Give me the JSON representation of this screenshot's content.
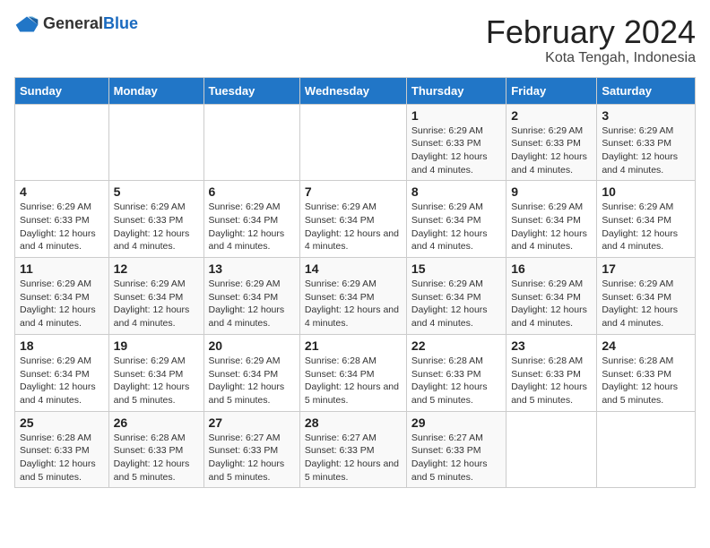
{
  "logo": {
    "text_general": "General",
    "text_blue": "Blue"
  },
  "title": "February 2024",
  "subtitle": "Kota Tengah, Indonesia",
  "days_of_week": [
    "Sunday",
    "Monday",
    "Tuesday",
    "Wednesday",
    "Thursday",
    "Friday",
    "Saturday"
  ],
  "weeks": [
    [
      {
        "day": "",
        "sunrise": "",
        "sunset": "",
        "daylight": ""
      },
      {
        "day": "",
        "sunrise": "",
        "sunset": "",
        "daylight": ""
      },
      {
        "day": "",
        "sunrise": "",
        "sunset": "",
        "daylight": ""
      },
      {
        "day": "",
        "sunrise": "",
        "sunset": "",
        "daylight": ""
      },
      {
        "day": "1",
        "sunrise": "Sunrise: 6:29 AM",
        "sunset": "Sunset: 6:33 PM",
        "daylight": "Daylight: 12 hours and 4 minutes."
      },
      {
        "day": "2",
        "sunrise": "Sunrise: 6:29 AM",
        "sunset": "Sunset: 6:33 PM",
        "daylight": "Daylight: 12 hours and 4 minutes."
      },
      {
        "day": "3",
        "sunrise": "Sunrise: 6:29 AM",
        "sunset": "Sunset: 6:33 PM",
        "daylight": "Daylight: 12 hours and 4 minutes."
      }
    ],
    [
      {
        "day": "4",
        "sunrise": "Sunrise: 6:29 AM",
        "sunset": "Sunset: 6:33 PM",
        "daylight": "Daylight: 12 hours and 4 minutes."
      },
      {
        "day": "5",
        "sunrise": "Sunrise: 6:29 AM",
        "sunset": "Sunset: 6:33 PM",
        "daylight": "Daylight: 12 hours and 4 minutes."
      },
      {
        "day": "6",
        "sunrise": "Sunrise: 6:29 AM",
        "sunset": "Sunset: 6:34 PM",
        "daylight": "Daylight: 12 hours and 4 minutes."
      },
      {
        "day": "7",
        "sunrise": "Sunrise: 6:29 AM",
        "sunset": "Sunset: 6:34 PM",
        "daylight": "Daylight: 12 hours and 4 minutes."
      },
      {
        "day": "8",
        "sunrise": "Sunrise: 6:29 AM",
        "sunset": "Sunset: 6:34 PM",
        "daylight": "Daylight: 12 hours and 4 minutes."
      },
      {
        "day": "9",
        "sunrise": "Sunrise: 6:29 AM",
        "sunset": "Sunset: 6:34 PM",
        "daylight": "Daylight: 12 hours and 4 minutes."
      },
      {
        "day": "10",
        "sunrise": "Sunrise: 6:29 AM",
        "sunset": "Sunset: 6:34 PM",
        "daylight": "Daylight: 12 hours and 4 minutes."
      }
    ],
    [
      {
        "day": "11",
        "sunrise": "Sunrise: 6:29 AM",
        "sunset": "Sunset: 6:34 PM",
        "daylight": "Daylight: 12 hours and 4 minutes."
      },
      {
        "day": "12",
        "sunrise": "Sunrise: 6:29 AM",
        "sunset": "Sunset: 6:34 PM",
        "daylight": "Daylight: 12 hours and 4 minutes."
      },
      {
        "day": "13",
        "sunrise": "Sunrise: 6:29 AM",
        "sunset": "Sunset: 6:34 PM",
        "daylight": "Daylight: 12 hours and 4 minutes."
      },
      {
        "day": "14",
        "sunrise": "Sunrise: 6:29 AM",
        "sunset": "Sunset: 6:34 PM",
        "daylight": "Daylight: 12 hours and 4 minutes."
      },
      {
        "day": "15",
        "sunrise": "Sunrise: 6:29 AM",
        "sunset": "Sunset: 6:34 PM",
        "daylight": "Daylight: 12 hours and 4 minutes."
      },
      {
        "day": "16",
        "sunrise": "Sunrise: 6:29 AM",
        "sunset": "Sunset: 6:34 PM",
        "daylight": "Daylight: 12 hours and 4 minutes."
      },
      {
        "day": "17",
        "sunrise": "Sunrise: 6:29 AM",
        "sunset": "Sunset: 6:34 PM",
        "daylight": "Daylight: 12 hours and 4 minutes."
      }
    ],
    [
      {
        "day": "18",
        "sunrise": "Sunrise: 6:29 AM",
        "sunset": "Sunset: 6:34 PM",
        "daylight": "Daylight: 12 hours and 4 minutes."
      },
      {
        "day": "19",
        "sunrise": "Sunrise: 6:29 AM",
        "sunset": "Sunset: 6:34 PM",
        "daylight": "Daylight: 12 hours and 5 minutes."
      },
      {
        "day": "20",
        "sunrise": "Sunrise: 6:29 AM",
        "sunset": "Sunset: 6:34 PM",
        "daylight": "Daylight: 12 hours and 5 minutes."
      },
      {
        "day": "21",
        "sunrise": "Sunrise: 6:28 AM",
        "sunset": "Sunset: 6:34 PM",
        "daylight": "Daylight: 12 hours and 5 minutes."
      },
      {
        "day": "22",
        "sunrise": "Sunrise: 6:28 AM",
        "sunset": "Sunset: 6:33 PM",
        "daylight": "Daylight: 12 hours and 5 minutes."
      },
      {
        "day": "23",
        "sunrise": "Sunrise: 6:28 AM",
        "sunset": "Sunset: 6:33 PM",
        "daylight": "Daylight: 12 hours and 5 minutes."
      },
      {
        "day": "24",
        "sunrise": "Sunrise: 6:28 AM",
        "sunset": "Sunset: 6:33 PM",
        "daylight": "Daylight: 12 hours and 5 minutes."
      }
    ],
    [
      {
        "day": "25",
        "sunrise": "Sunrise: 6:28 AM",
        "sunset": "Sunset: 6:33 PM",
        "daylight": "Daylight: 12 hours and 5 minutes."
      },
      {
        "day": "26",
        "sunrise": "Sunrise: 6:28 AM",
        "sunset": "Sunset: 6:33 PM",
        "daylight": "Daylight: 12 hours and 5 minutes."
      },
      {
        "day": "27",
        "sunrise": "Sunrise: 6:27 AM",
        "sunset": "Sunset: 6:33 PM",
        "daylight": "Daylight: 12 hours and 5 minutes."
      },
      {
        "day": "28",
        "sunrise": "Sunrise: 6:27 AM",
        "sunset": "Sunset: 6:33 PM",
        "daylight": "Daylight: 12 hours and 5 minutes."
      },
      {
        "day": "29",
        "sunrise": "Sunrise: 6:27 AM",
        "sunset": "Sunset: 6:33 PM",
        "daylight": "Daylight: 12 hours and 5 minutes."
      },
      {
        "day": "",
        "sunrise": "",
        "sunset": "",
        "daylight": ""
      },
      {
        "day": "",
        "sunrise": "",
        "sunset": "",
        "daylight": ""
      }
    ]
  ]
}
